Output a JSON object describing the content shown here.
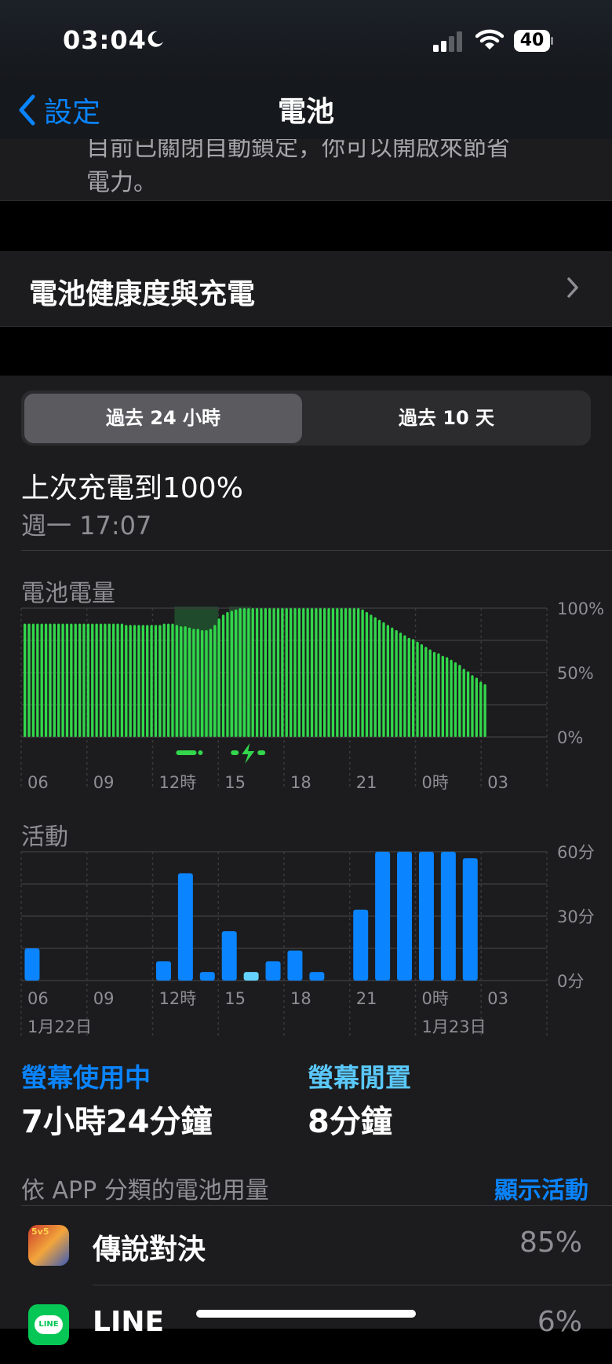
{
  "status_bar": {
    "time": "03:04",
    "battery": "40"
  },
  "nav": {
    "back_label": "設定",
    "title": "電池"
  },
  "top_note": {
    "line1": "目前已關閉自動鎖定，你可以開啟來節省",
    "line2": "電力。"
  },
  "health": {
    "label": "電池健康度與充電"
  },
  "segments": {
    "active": "過去 24 小時",
    "inactive": "過去 10 天"
  },
  "last_charge": {
    "title": "上次充電到100%",
    "time": "週一 17:07"
  },
  "battery_chart": {
    "label": "電池電量",
    "y_labels": [
      "100%",
      "50%",
      "0%"
    ],
    "x_labels": [
      "06",
      "09",
      "12時",
      "15",
      "18",
      "21",
      "0時",
      "03"
    ]
  },
  "activity_chart": {
    "label": "活動",
    "y_labels": [
      "60分",
      "30分",
      "0分"
    ],
    "x_labels": [
      "06",
      "09",
      "12時",
      "15",
      "18",
      "21",
      "0時",
      "03"
    ],
    "date_labels": [
      "1月22日",
      "1月23日"
    ]
  },
  "chart_data": [
    {
      "type": "bar",
      "title": "電池電量",
      "ylim": [
        0,
        100
      ],
      "y_unit": "%",
      "x_ticks": [
        "06",
        "09",
        "12時",
        "15",
        "18",
        "21",
        "0時",
        "03"
      ],
      "values": [
        88,
        88,
        88,
        88,
        88,
        88,
        88,
        88,
        88,
        88,
        88,
        88,
        88,
        88,
        88,
        88,
        88,
        88,
        88,
        88,
        88,
        88,
        88,
        88,
        87,
        87,
        87,
        87,
        87,
        87,
        87,
        87,
        87,
        88,
        88,
        88,
        87,
        86,
        86,
        85,
        84,
        84,
        83,
        83,
        84,
        87,
        92,
        95,
        97,
        98,
        99,
        100,
        100,
        100,
        100,
        100,
        100,
        100,
        100,
        100,
        100,
        100,
        100,
        100,
        100,
        100,
        100,
        100,
        100,
        100,
        100,
        100,
        100,
        100,
        100,
        100,
        100,
        100,
        100,
        100,
        99,
        97,
        95,
        93,
        91,
        89,
        87,
        85,
        83,
        81,
        79,
        77,
        76,
        74,
        72,
        70,
        68,
        66,
        65,
        63,
        62,
        60,
        58,
        56,
        53,
        51,
        48,
        46,
        43,
        41
      ],
      "charging_intervals": [
        "~13:00-15:00",
        "~15:30-16:30"
      ]
    },
    {
      "type": "bar",
      "title": "活動",
      "ylim": [
        0,
        60
      ],
      "y_unit": "分",
      "categories": [
        "06",
        "07",
        "08",
        "09",
        "10",
        "11",
        "12",
        "13",
        "14",
        "15",
        "16",
        "17",
        "18",
        "19",
        "20",
        "21",
        "22",
        "23",
        "00",
        "01",
        "02",
        "03"
      ],
      "series": [
        {
          "name": "螢幕使用中",
          "color": "#0a84ff",
          "values": [
            15,
            0,
            0,
            0,
            0,
            0,
            9,
            50,
            4,
            23,
            0,
            9,
            14,
            4,
            0,
            33,
            60,
            60,
            60,
            60,
            57,
            0
          ]
        },
        {
          "name": "螢幕閒置",
          "color": "#64d2ff",
          "values": [
            0,
            0,
            0,
            0,
            0,
            0,
            0,
            0,
            0,
            0,
            4,
            0,
            0,
            0,
            0,
            0,
            0,
            0,
            0,
            0,
            0,
            0
          ]
        }
      ]
    }
  ],
  "usage": {
    "screen_on_label": "螢幕使用中",
    "screen_on_value": "7小時24分鐘",
    "screen_idle_label": "螢幕閒置",
    "screen_idle_value": "8分鐘"
  },
  "apps": {
    "header": "依 APP 分類的電池用量",
    "show_activity": "顯示活動",
    "list": [
      {
        "name": "傳說對決",
        "pct": "85%"
      },
      {
        "name": "LINE",
        "pct": "6%"
      }
    ]
  }
}
